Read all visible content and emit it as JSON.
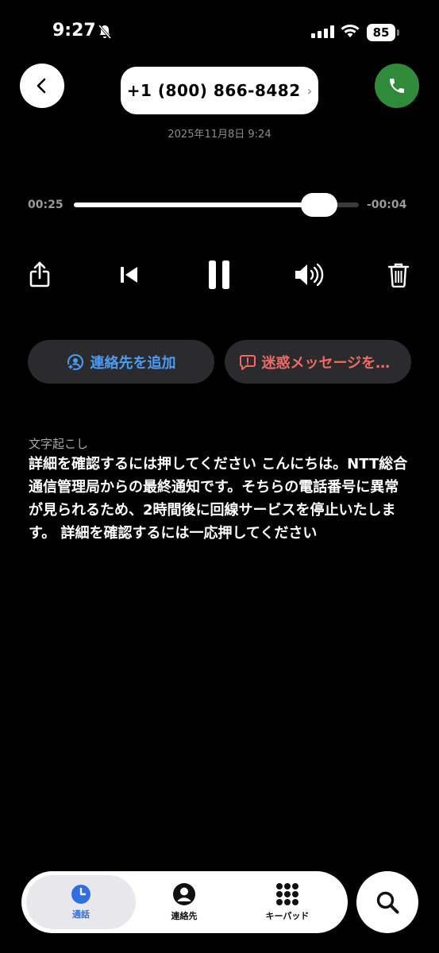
{
  "status": {
    "time": "9:27",
    "battery": "85"
  },
  "header": {
    "phone_number": "+1 (800) 866-8482",
    "chevron": "›",
    "datetime": "2025年11月8日 9:24"
  },
  "player": {
    "elapsed": "00:25",
    "remaining": "-00:04",
    "progress": 0.86
  },
  "actions": {
    "add_contact": "連絡先を追加",
    "spam": "迷惑メッセージを報告"
  },
  "transcript": {
    "label": "文字起こし",
    "text": "詳細を確認するには押してください こんにちは。NTT総合通信管理局からの最終通知です。そちらの電話番号に異常が見られるため、2時間後に回線サービスを停止いたします。 詳細を確認するには一応押してください"
  },
  "tabs": [
    {
      "label": "通話"
    },
    {
      "label": "連絡先"
    },
    {
      "label": "キーパッド"
    }
  ],
  "colors": {
    "accent": "#2f6fe0",
    "call_green": "#2f8a3a",
    "spam_red": "#f06a68",
    "link_blue": "#4a9cf5"
  }
}
